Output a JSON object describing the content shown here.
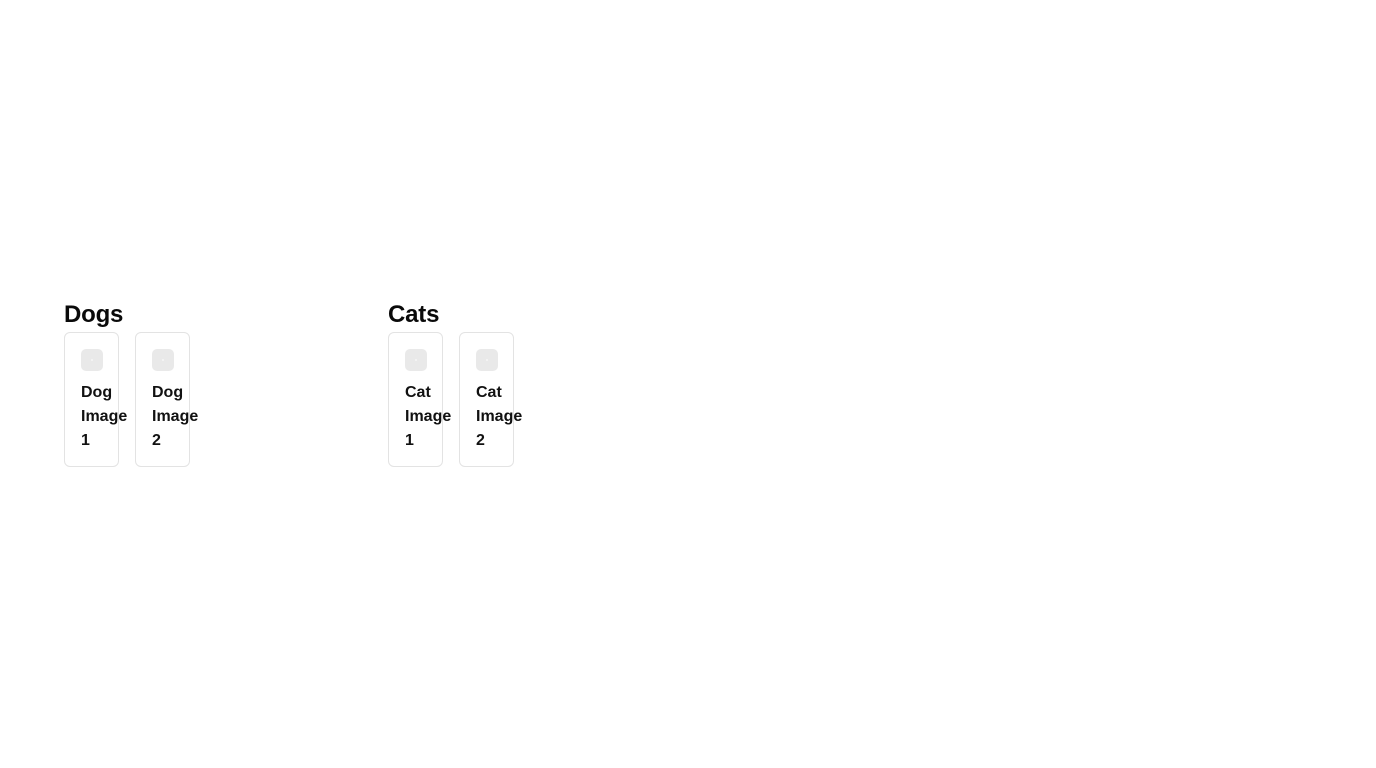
{
  "sections": [
    {
      "title": "Dogs",
      "items": [
        {
          "label": "Dog Image 1",
          "icon": "image-placeholder-icon"
        },
        {
          "label": "Dog Image 2",
          "icon": "image-placeholder-icon"
        }
      ]
    },
    {
      "title": "Cats",
      "items": [
        {
          "label": "Cat Image 1",
          "icon": "image-placeholder-icon"
        },
        {
          "label": "Cat Image 2",
          "icon": "image-placeholder-icon"
        }
      ]
    }
  ],
  "colors": {
    "background": "#ffffff",
    "card_border": "#e3e3e3",
    "thumbnail": "#e9e9e9",
    "text": "#111111"
  }
}
